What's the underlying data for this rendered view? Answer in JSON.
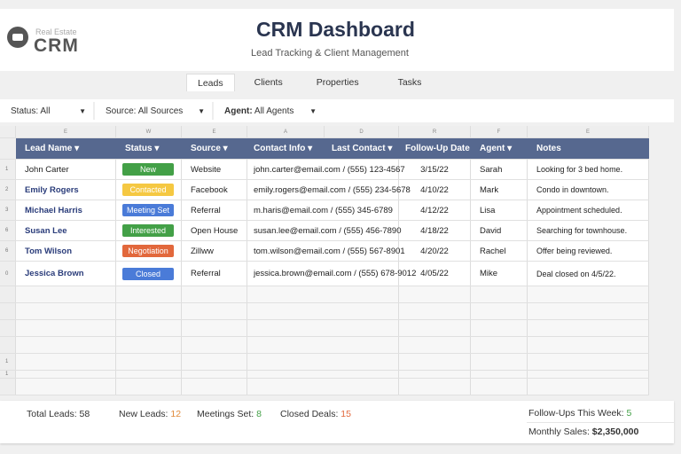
{
  "header": {
    "logo_small": "Real Estate",
    "logo_big": "CRM",
    "title": "CRM Dashboard",
    "subtitle": "Lead Tracking & Client Management"
  },
  "tabs": [
    "Leads",
    "Clients",
    "Properties",
    "Tasks"
  ],
  "filters": [
    {
      "label": "Status: All"
    },
    {
      "label": "Source: All Sources"
    },
    {
      "label": "Agent:",
      "value": " All Agents"
    }
  ],
  "column_letters": [
    "E",
    "W",
    "E",
    "A",
    "D",
    "R",
    "F",
    "E"
  ],
  "columns": [
    "Lead Name ▾",
    "Status ▾",
    "Source ▾",
    "Contact Info ▾",
    "Last Contact ▾",
    "Follow-Up Date",
    "Agent ▾",
    "Notes"
  ],
  "rows": [
    {
      "num": "1",
      "name": "John Carter",
      "status": "New",
      "status_color": "#43a047",
      "source": "Website",
      "contact": "john.carter@email.com / (555) 123-4567",
      "followup": "3/15/22",
      "agent": "Sarah",
      "notes": "Looking for 3 bed home."
    },
    {
      "num": "2",
      "name": "Emily Rogers",
      "status": "Contacted",
      "status_color": "#f5c842",
      "source": "Facebook",
      "contact": "emily.rogers@email.com / (555) 234-5678",
      "followup": "4/10/22",
      "agent": "Mark",
      "notes": "Condo in downtown."
    },
    {
      "num": "3",
      "name": "Michael Harris",
      "status": "Meeting Set",
      "status_color": "#4a7bd8",
      "source": "Referral",
      "contact": "m.haris@email.com / (555) 345-6789",
      "followup": "4/12/22",
      "agent": "Lisa",
      "notes": "Appointment scheduled."
    },
    {
      "num": "6",
      "name": "Susan Lee",
      "status": "Interested",
      "status_color": "#43a047",
      "source": "Open House",
      "contact": "susan.lee@email.com / (555) 456-7890",
      "followup": "4/18/22",
      "agent": "David",
      "notes": "Searching for townhouse."
    },
    {
      "num": "6",
      "name": "Tom Wilson",
      "status": "Negotiation",
      "status_color": "#e2683c",
      "source": "Zillww",
      "contact": "tom.wilson@email.com / (555) 567-8901",
      "followup": "4/20/22",
      "agent": "Rachel",
      "notes": "Offer being reviewed."
    },
    {
      "num": "0",
      "name": "Jessica Brown",
      "status": "Closed",
      "status_color": "#4a7bd8",
      "source": "Referral",
      "contact": "jessica.brown@email.com / (555) 678-9012",
      "followup": "4/05/22",
      "agent": "Mike",
      "notes": "Deal closed on 4/5/22."
    }
  ],
  "empty_row_numbers": [
    "",
    "",
    "",
    "",
    "1",
    "1",
    ""
  ],
  "footer": {
    "total_leads_label": "Total Leads:",
    "total_leads": "58",
    "new_leads_label": "New Leads:",
    "new_leads": "12",
    "meetings_label": "Meetings Set:",
    "meetings": "8",
    "closed_label": "Closed Deals:",
    "closed": "15",
    "followups_label": "Follow-Ups This Week:",
    "followups": "5",
    "sales_label": "Monthly Sales:",
    "sales": "$2,350,000"
  },
  "colors": {
    "header_bg": "#56688f",
    "orange": "#e08a3a",
    "green": "#43a047",
    "red": "#e2683c"
  }
}
